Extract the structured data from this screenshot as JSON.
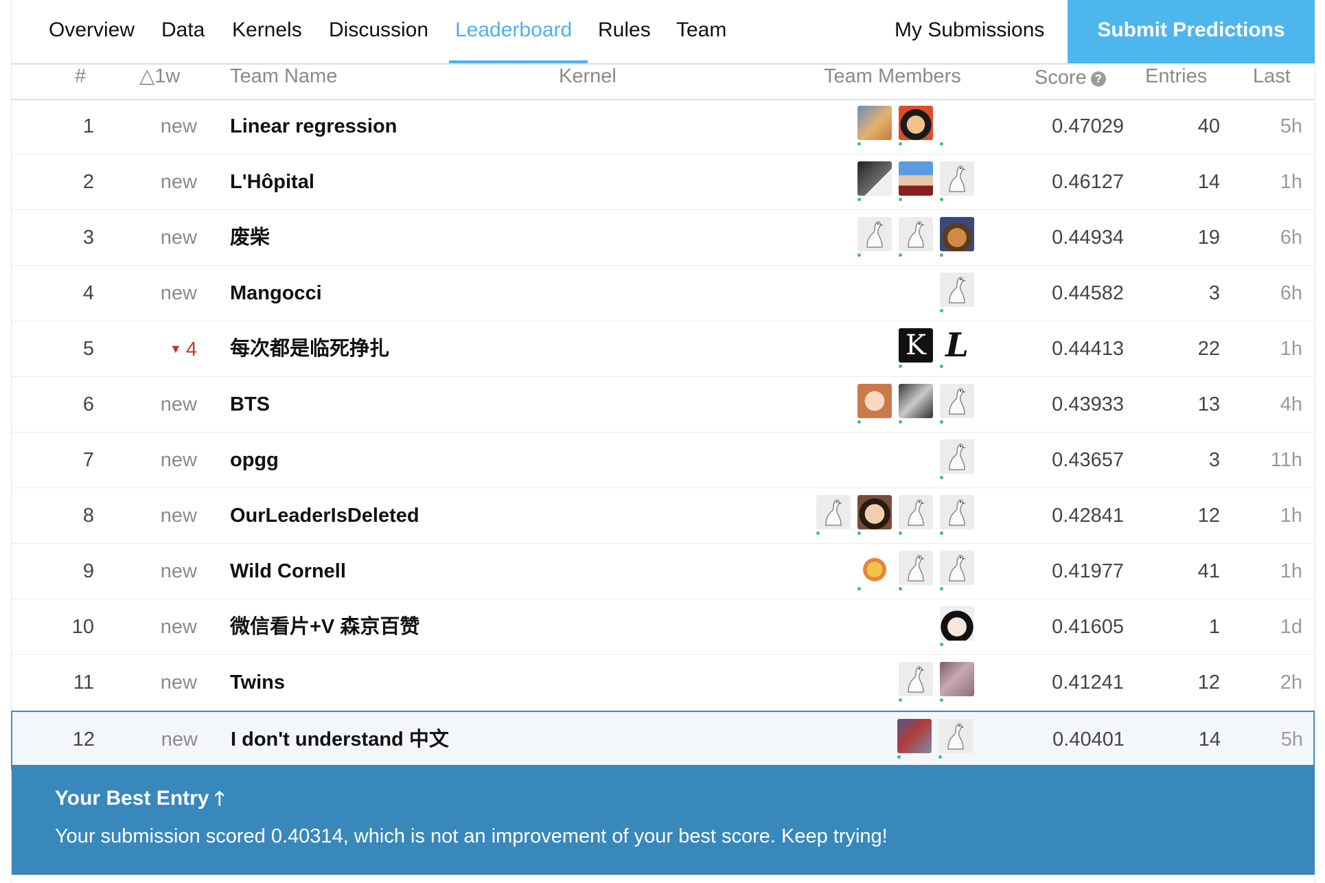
{
  "tabs": [
    {
      "label": "Overview",
      "active": false
    },
    {
      "label": "Data",
      "active": false
    },
    {
      "label": "Kernels",
      "active": false
    },
    {
      "label": "Discussion",
      "active": false
    },
    {
      "label": "Leaderboard",
      "active": true
    },
    {
      "label": "Rules",
      "active": false
    },
    {
      "label": "Team",
      "active": false
    }
  ],
  "my_submissions_label": "My Submissions",
  "submit_label": "Submit Predictions",
  "accent_color": "#4fb0ea",
  "columns": {
    "rank": "#",
    "change": "△1w",
    "team": "Team Name",
    "kernel": "Kernel",
    "members": "Team Members",
    "score": "Score",
    "entries": "Entries",
    "last": "Last"
  },
  "score_help_icon": "question-circle-icon",
  "rows": [
    {
      "rank": "1",
      "change": "new",
      "team": "Linear regression",
      "score": "0.47029",
      "entries": "40",
      "last": "5h",
      "members": [
        "img1",
        "img2",
        "img3"
      ]
    },
    {
      "rank": "2",
      "change": "new",
      "team": "L'Hôpital",
      "score": "0.46127",
      "entries": "14",
      "last": "1h",
      "members": [
        "img4",
        "img5",
        "goose"
      ]
    },
    {
      "rank": "3",
      "change": "new",
      "team": "废柴",
      "score": "0.44934",
      "entries": "19",
      "last": "6h",
      "members": [
        "goose",
        "goose",
        "img6"
      ]
    },
    {
      "rank": "4",
      "change": "new",
      "team": "Mangocci",
      "score": "0.44582",
      "entries": "3",
      "last": "6h",
      "members": [
        "goose"
      ]
    },
    {
      "rank": "5",
      "change": "4",
      "change_dir": "down",
      "team": "每次都是临死挣扎",
      "score": "0.44413",
      "entries": "22",
      "last": "1h",
      "members": [
        "img7",
        "img8"
      ]
    },
    {
      "rank": "6",
      "change": "new",
      "team": "BTS",
      "score": "0.43933",
      "entries": "13",
      "last": "4h",
      "members": [
        "img9",
        "img10",
        "goose"
      ]
    },
    {
      "rank": "7",
      "change": "new",
      "team": "opgg",
      "score": "0.43657",
      "entries": "3",
      "last": "11h",
      "members": [
        "goose"
      ]
    },
    {
      "rank": "8",
      "change": "new",
      "team": "OurLeaderIsDeleted",
      "score": "0.42841",
      "entries": "12",
      "last": "1h",
      "members": [
        "goose",
        "img11",
        "goose",
        "goose"
      ]
    },
    {
      "rank": "9",
      "change": "new",
      "team": "Wild Cornell",
      "score": "0.41977",
      "entries": "41",
      "last": "1h",
      "members": [
        "img12",
        "goose",
        "goose"
      ]
    },
    {
      "rank": "10",
      "change": "new",
      "team": "微信看片+V 森京百赞",
      "score": "0.41605",
      "entries": "1",
      "last": "1d",
      "members": [
        "img13"
      ]
    },
    {
      "rank": "11",
      "change": "new",
      "team": "Twins",
      "score": "0.41241",
      "entries": "12",
      "last": "2h",
      "members": [
        "goose",
        "img14"
      ]
    },
    {
      "rank": "12",
      "change": "new",
      "team": "I don't understand 中文",
      "score": "0.40401",
      "entries": "14",
      "last": "5h",
      "members": [
        "img15",
        "goose"
      ],
      "highlighted": true
    }
  ],
  "best_entry": {
    "title": "Your Best Entry",
    "icon": "arrow-up-icon",
    "message": "Your submission scored 0.40314, which is not an improvement of your best score. Keep trying!",
    "background": "#3888bb"
  },
  "avatar_texts": {
    "img7": "K",
    "img8": "L"
  }
}
